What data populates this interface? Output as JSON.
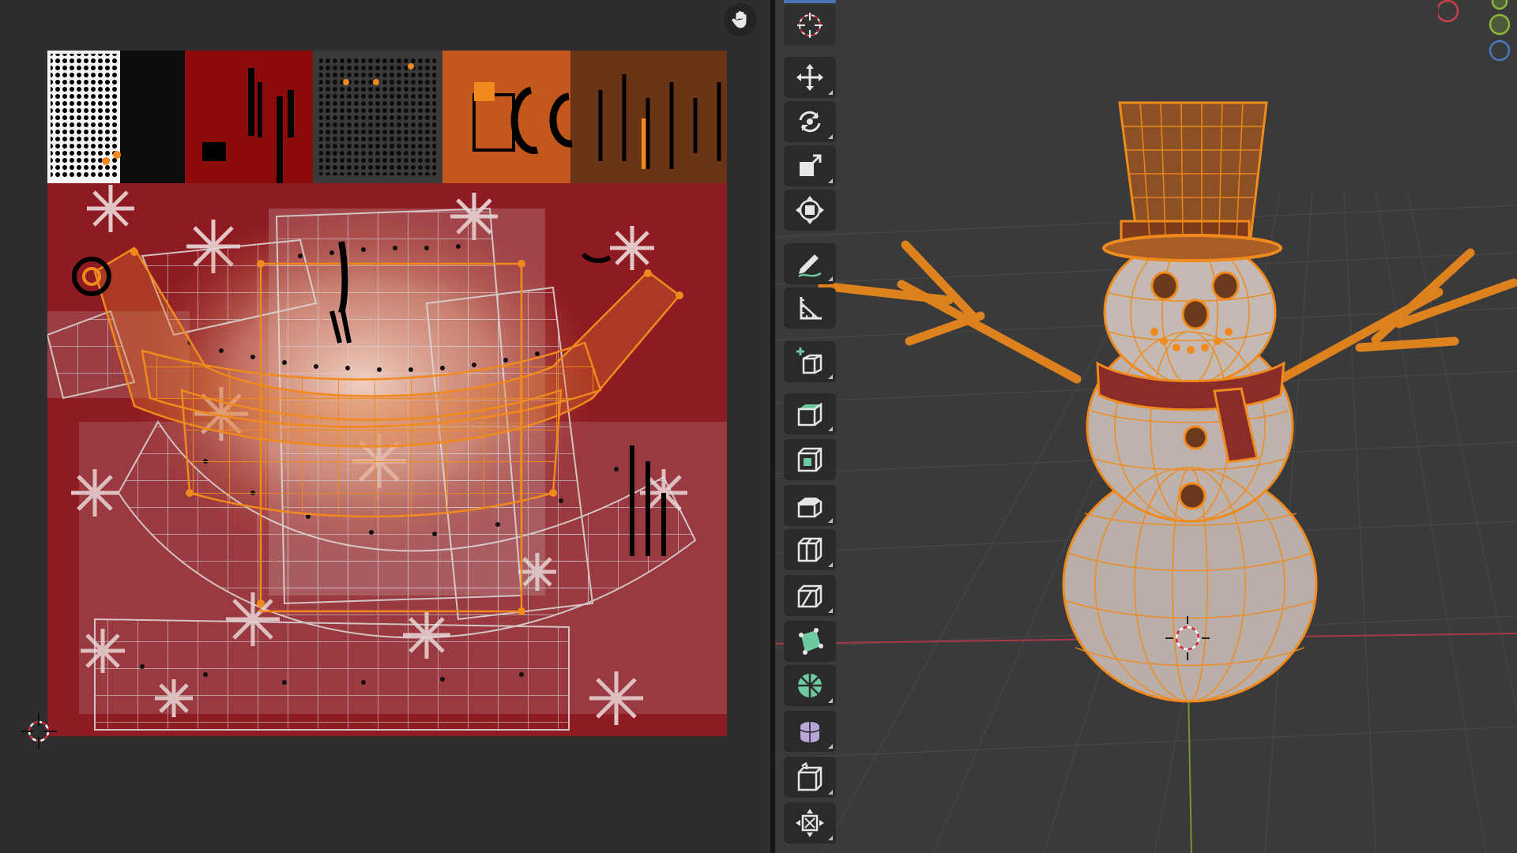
{
  "uv_editor": {
    "navigation": {
      "icon": "hand-pan-icon"
    }
  },
  "toolbar": {
    "tools": [
      {
        "name": "cursor",
        "icon": "cursor-icon",
        "active": true
      },
      {
        "name": "move",
        "icon": "move-icon"
      },
      {
        "name": "rotate",
        "icon": "rotate-icon"
      },
      {
        "name": "scale",
        "icon": "scale-icon"
      },
      {
        "name": "transform",
        "icon": "transform-icon"
      },
      {
        "name": "annotate",
        "icon": "annotate-icon"
      },
      {
        "name": "measure",
        "icon": "measure-icon"
      },
      {
        "name": "add-cube",
        "icon": "add-cube-icon"
      },
      {
        "name": "extrude-region",
        "icon": "extrude-region-icon"
      },
      {
        "name": "inset-faces",
        "icon": "inset-faces-icon"
      },
      {
        "name": "bevel",
        "icon": "bevel-icon"
      },
      {
        "name": "loop-cut",
        "icon": "loop-cut-icon"
      },
      {
        "name": "knife",
        "icon": "knife-icon"
      },
      {
        "name": "poly-build",
        "icon": "poly-build-icon"
      },
      {
        "name": "spin",
        "icon": "spin-icon"
      },
      {
        "name": "smooth",
        "icon": "smooth-icon"
      },
      {
        "name": "edge-slide",
        "icon": "edge-slide-icon"
      },
      {
        "name": "shrink-fatten",
        "icon": "shrink-fatten-icon"
      }
    ]
  },
  "colors": {
    "selection": "#f08a1c",
    "uv_background": "#2e2e2e",
    "viewport_background": "#3a3a3a",
    "sweater_red": "#8e1a22",
    "snow_body": "#b9aea8",
    "gizmo_x": "#c8414b",
    "gizmo_y": "#8bb83b",
    "gizmo_z": "#4a7ac0"
  },
  "gizmo": {
    "axes": [
      "x",
      "y",
      "z"
    ]
  }
}
